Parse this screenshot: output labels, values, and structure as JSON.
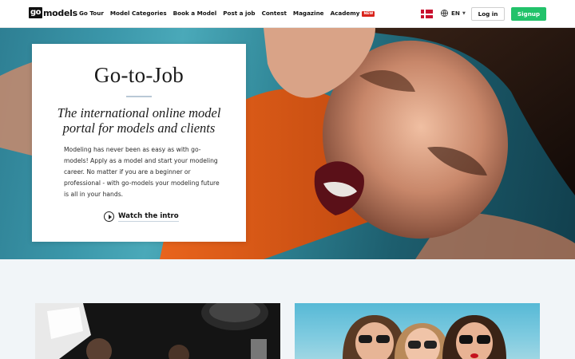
{
  "nav": {
    "logo_mark": "go",
    "logo_text": "models",
    "items": [
      "Go Tour",
      "Model Categories",
      "Book a Model",
      "Post a job",
      "Contest",
      "Magazine",
      "Academy"
    ],
    "academy_badge": "NEW",
    "language": "EN",
    "login_label": "Log in",
    "signup_label": "Signup"
  },
  "hero": {
    "title": "Go-to-Job",
    "subtitle": "The international online model portal for models and clients",
    "body": "Modeling has never been as easy as with go-models! Apply as a model and start your modeling career. No matter if you are a beginner or professional - with go-models your modeling future is all in your hands.",
    "watch_label": "Watch the intro"
  },
  "colors": {
    "accent_green": "#22c26a",
    "badge_red": "#d9241c",
    "page_background": "#f1f5f8"
  }
}
